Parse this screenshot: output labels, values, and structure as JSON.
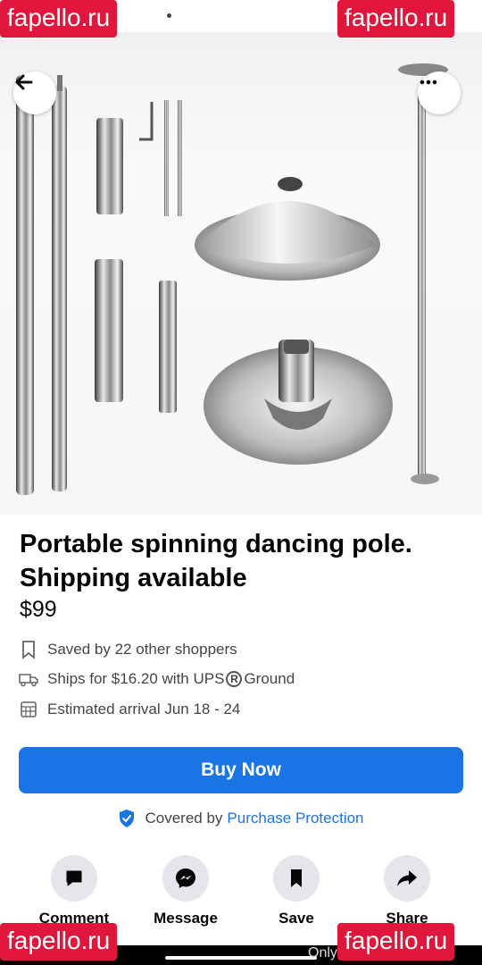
{
  "status_bar": {
    "indicators": [
      "dot",
      "dot"
    ]
  },
  "gallery": {
    "image_alt": "Chrome dance pole parts",
    "photo_count": 5,
    "active_index": 0,
    "back_icon": "arrow-left-icon",
    "more_icon": "more-horizontal-icon"
  },
  "listing": {
    "title": "Portable spinning dancing pole. Shipping available",
    "price": "$99",
    "saved_text": "Saved by 22 other shoppers",
    "ships_prefix": "Ships for $16.20 with UPS",
    "ships_reg": "R",
    "ships_suffix": "Ground",
    "arrival_text": "Estimated arrival Jun 18 - 24"
  },
  "buy_button": {
    "label": "Buy Now",
    "color": "#1b74e4"
  },
  "protection": {
    "prefix": "Covered by",
    "link": "Purchase Protection"
  },
  "actions": [
    {
      "label": "Comment",
      "icon": "comment-icon"
    },
    {
      "label": "Message",
      "icon": "messenger-icon"
    },
    {
      "label": "Save",
      "icon": "bookmark-icon"
    },
    {
      "label": "Share",
      "icon": "share-icon"
    }
  ],
  "nav_bar": {
    "partial_text": "Only"
  },
  "watermarks": [
    "fapello.ru",
    "fapello.ru",
    "fapello.ru",
    "fapello.ru"
  ]
}
